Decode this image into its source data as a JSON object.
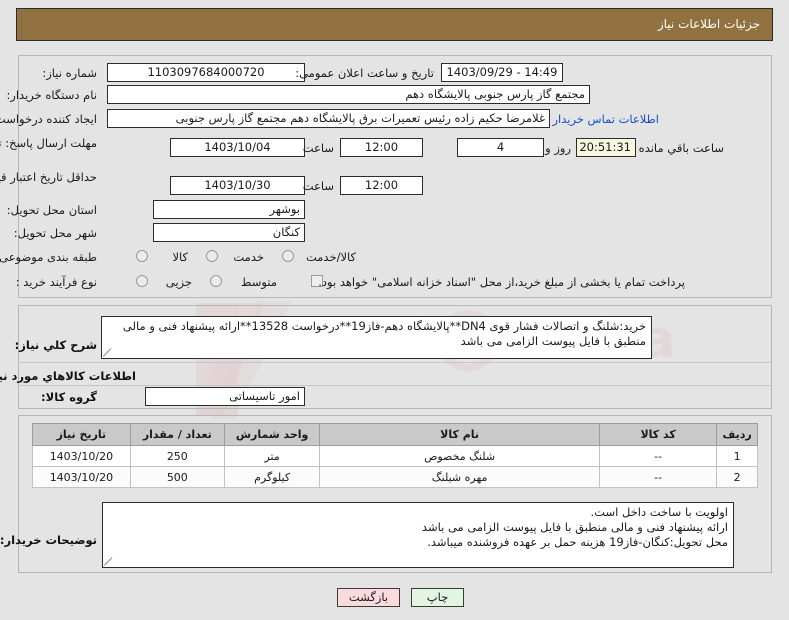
{
  "window": {
    "title": "جزئیات اطلاعات نیاز"
  },
  "fields": {
    "need_number": {
      "label": "شماره نیاز:",
      "value": "1103097684000720"
    },
    "public_announce": {
      "label": "تاریخ و ساعت اعلان عمومی:",
      "value": "14:49 - 1403/09/29"
    },
    "buyer_org": {
      "label": "نام دستگاه خریدار:",
      "value": "مجتمع گاز پارس جنوبی  پالایشگاه دهم"
    },
    "request_creator": {
      "label": "ایجاد کننده درخواست:",
      "value": "غلامرضا حکیم زاده رئیس تعمیرات برق پالایشگاه دهم  مجتمع گاز پارس جنوبی"
    },
    "buyer_contact_link": "اطلاعات تماس خریدار",
    "response_deadline": {
      "label": "مهلت ارسال پاسخ: تا تاریخ:",
      "date": "1403/10/04",
      "time_label": "ساعت",
      "time": "12:00",
      "days": "4",
      "days_unit": "روز و",
      "countdown": "20:51:31",
      "countdown_unit": "ساعت باقي مانده"
    },
    "price_validity": {
      "label": "حداقل تاریخ اعتبار قیمت: تا تاریخ:",
      "date": "1403/10/30",
      "time_label": "ساعت",
      "time": "12:00"
    },
    "delivery_province": {
      "label": "استان محل تحویل:",
      "value": "بوشهر"
    },
    "delivery_city": {
      "label": "شهر محل تحویل:",
      "value": "کنگان"
    },
    "subject_class": {
      "label": "طبقه بندی موضوعی:",
      "options": [
        "کالا",
        "خدمت",
        "کالا/خدمت"
      ]
    },
    "purchase_type": {
      "label": "نوع فرآیند خرید :",
      "options": [
        "جزیی",
        "متوسط"
      ],
      "checkbox_text": "پرداخت تمام یا بخشی از مبلغ خرید،از محل \"اسناد خزانه اسلامی\" خواهد بود."
    }
  },
  "description": {
    "label": "شرح كلي نياز:",
    "text": "خرید:شلنگ و اتصالات فشار قوی DN4**پالایشگاه دهم-فاز19**درخواست 13528**ارائه پیشنهاد فنی و مالی منطبق با فایل پیوست الزامی می باشد"
  },
  "items_section": {
    "heading": "اطلاعات کالاهاي مورد نیاز",
    "group_label": "گروه کالا:",
    "group_value": "امور تاسیساتی",
    "columns": [
      "ردیف",
      "کد کالا",
      "نام کالا",
      "واحد شمارش",
      "تعداد / مقدار",
      "تاریخ نیاز"
    ],
    "rows": [
      {
        "row": "1",
        "code": "--",
        "name": "شلنگ مخصوص",
        "unit": "متر",
        "qty": "250",
        "date": "1403/10/20"
      },
      {
        "row": "2",
        "code": "--",
        "name": "مهره شیلنگ",
        "unit": "کیلوگرم",
        "qty": "500",
        "date": "1403/10/20"
      }
    ]
  },
  "buyer_notes": {
    "label": "توضیحات خریدار:",
    "line1": "اولویت با ساخت داخل است.",
    "line2": "ارائه پیشنهاد فنی و مالی منطبق با فایل پیوست الزامی می باشد",
    "line3": "محل تحویل:کنگان-فاز19 هزینه حمل بر عهده فروشنده میباشد."
  },
  "buttons": {
    "back": "بازگشت",
    "print": "چاپ"
  },
  "colors": {
    "header_bg": "#90713f",
    "page_bg": "#e4e4e4",
    "link": "#1450c8",
    "timer_bg": "#f7f7e0",
    "back_btn_bg": "#fadadd",
    "print_btn_bg": "#e2f4e2",
    "table_header_bg": "#c9c9c9"
  }
}
